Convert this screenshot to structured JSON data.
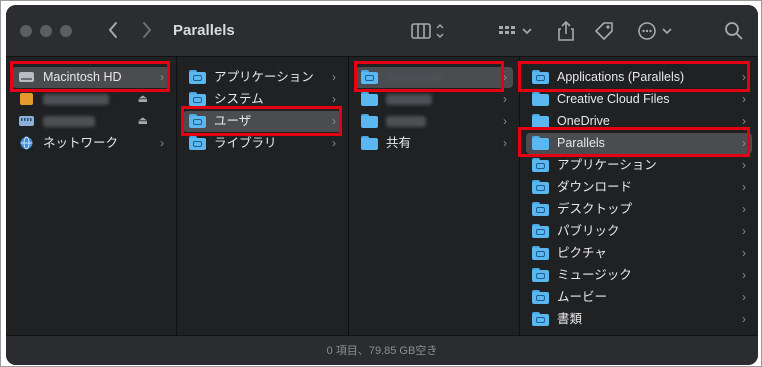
{
  "window": {
    "title": "Parallels"
  },
  "toolbar": {
    "back_icon": "chevron-left-icon",
    "forward_icon": "chevron-right-icon",
    "view_icon": "column-view-icon",
    "group_icon": "group-grid-icon",
    "share_icon": "share-icon",
    "tag_icon": "tag-icon",
    "more_icon": "ellipsis-circle-icon",
    "search_icon": "search-icon"
  },
  "columns": {
    "col1": [
      {
        "label": "Macintosh HD",
        "icon": "hard-drive-icon",
        "selected": true
      },
      {
        "label": "",
        "icon": "external-drive-icon",
        "eject": "⏏",
        "redacted": true
      },
      {
        "label": "",
        "icon": "server-drive-icon",
        "eject": "⏏",
        "redacted": true
      },
      {
        "label": "ネットワーク",
        "icon": "network-globe-icon"
      }
    ],
    "col2": [
      {
        "label": "アプリケーション",
        "icon": "folder-icon"
      },
      {
        "label": "システム",
        "icon": "folder-icon"
      },
      {
        "label": "ユーザ",
        "icon": "folder-icon",
        "selected": true
      },
      {
        "label": "ライブラリ",
        "icon": "folder-icon"
      }
    ],
    "col3": [
      {
        "label": "",
        "icon": "home-folder-icon",
        "selected": true,
        "redacted": true
      },
      {
        "label": "",
        "icon": "folder-icon",
        "redacted": true
      },
      {
        "label": "",
        "icon": "folder-icon",
        "redacted": true
      },
      {
        "label": "共有",
        "icon": "folder-icon"
      }
    ],
    "col4": [
      {
        "label": "Applications (Parallels)",
        "icon": "folder-icon"
      },
      {
        "label": "Creative Cloud Files",
        "icon": "folder-icon"
      },
      {
        "label": "OneDrive",
        "icon": "folder-icon"
      },
      {
        "label": "Parallels",
        "icon": "folder-icon",
        "selected": true
      },
      {
        "label": "アプリケーション",
        "icon": "folder-icon"
      },
      {
        "label": "ダウンロード",
        "icon": "folder-icon"
      },
      {
        "label": "デスクトップ",
        "icon": "folder-icon"
      },
      {
        "label": "パブリック",
        "icon": "folder-icon"
      },
      {
        "label": "ピクチャ",
        "icon": "folder-icon"
      },
      {
        "label": "ミュージック",
        "icon": "folder-icon"
      },
      {
        "label": "ムービー",
        "icon": "folder-icon"
      },
      {
        "label": "書類",
        "icon": "folder-icon"
      }
    ]
  },
  "status": {
    "text": "0 項目、79.85 GB空き"
  },
  "colors": {
    "highlight": "#e50012",
    "folder": "#5bb7f0",
    "window_bg": "#1f2123",
    "selection": "#4a4c4f"
  }
}
